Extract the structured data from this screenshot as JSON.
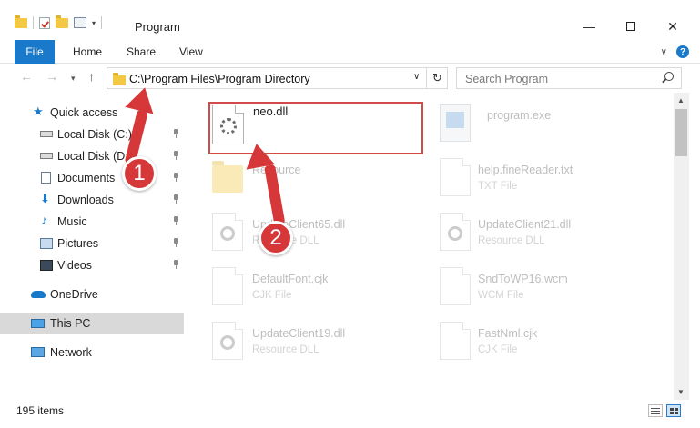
{
  "window": {
    "title": "Program",
    "minimize_glyph": "—",
    "close_glyph": "✕"
  },
  "ribbon": {
    "tabs": [
      {
        "label": "File"
      },
      {
        "label": "Home"
      },
      {
        "label": "Share"
      },
      {
        "label": "View"
      }
    ],
    "collapse_glyph": "∨",
    "help_glyph": "?"
  },
  "navigation": {
    "back_glyph": "←",
    "forward_glyph": "→",
    "recent_glyph": "▾",
    "up_glyph": "↑",
    "address": "C:\\Program Files\\Program Directory",
    "address_caret": "∨",
    "refresh_glyph": "↻",
    "search_placeholder": "Search Program"
  },
  "sidebar": {
    "items": [
      {
        "label": "Quick access",
        "icon": "star-icon",
        "pinned": false
      },
      {
        "label": "Local Disk (C:)",
        "icon": "drive-icon",
        "pinned": true
      },
      {
        "label": "Local Disk (D:)",
        "icon": "drive-icon",
        "pinned": true
      },
      {
        "label": "Documents",
        "icon": "documents-icon",
        "pinned": true
      },
      {
        "label": "Downloads",
        "icon": "downloads-icon",
        "pinned": true
      },
      {
        "label": "Music",
        "icon": "music-icon",
        "pinned": true
      },
      {
        "label": "Pictures",
        "icon": "pictures-icon",
        "pinned": true
      },
      {
        "label": "Videos",
        "icon": "videos-icon",
        "pinned": true
      },
      {
        "label": "OneDrive",
        "icon": "onedrive-icon",
        "pinned": false
      },
      {
        "label": "This PC",
        "icon": "this-pc-icon",
        "pinned": false,
        "selected": true
      },
      {
        "label": "Network",
        "icon": "network-icon",
        "pinned": false
      }
    ],
    "glyphs": {
      "star": "★",
      "download": "⬇",
      "music": "♪"
    }
  },
  "files": {
    "highlighted": {
      "name": "neo.dll"
    },
    "items": [
      {
        "name": "program.exe",
        "type": ""
      },
      {
        "name": "Resource",
        "type": ""
      },
      {
        "name": "help.fineReader.txt",
        "type": "TXT File"
      },
      {
        "name": "UpdateClient65.dll",
        "type": "Resource DLL"
      },
      {
        "name": "UpdateClient21.dll",
        "type": "Resource DLL"
      },
      {
        "name": "DefaultFont.cjk",
        "type": "CJK File"
      },
      {
        "name": "SndToWP16.wcm",
        "type": "WCM File"
      },
      {
        "name": "UpdateClient19.dll",
        "type": "Resource DLL"
      },
      {
        "name": "FastNml.cjk",
        "type": "CJK File"
      }
    ]
  },
  "callouts": [
    {
      "number": "1"
    },
    {
      "number": "2"
    }
  ],
  "accent_color": "#1979ca",
  "callout_color": "#d6383a",
  "scrollbar": {
    "up_glyph": "▲",
    "down_glyph": "▼"
  },
  "status": {
    "item_count": "195 items"
  }
}
